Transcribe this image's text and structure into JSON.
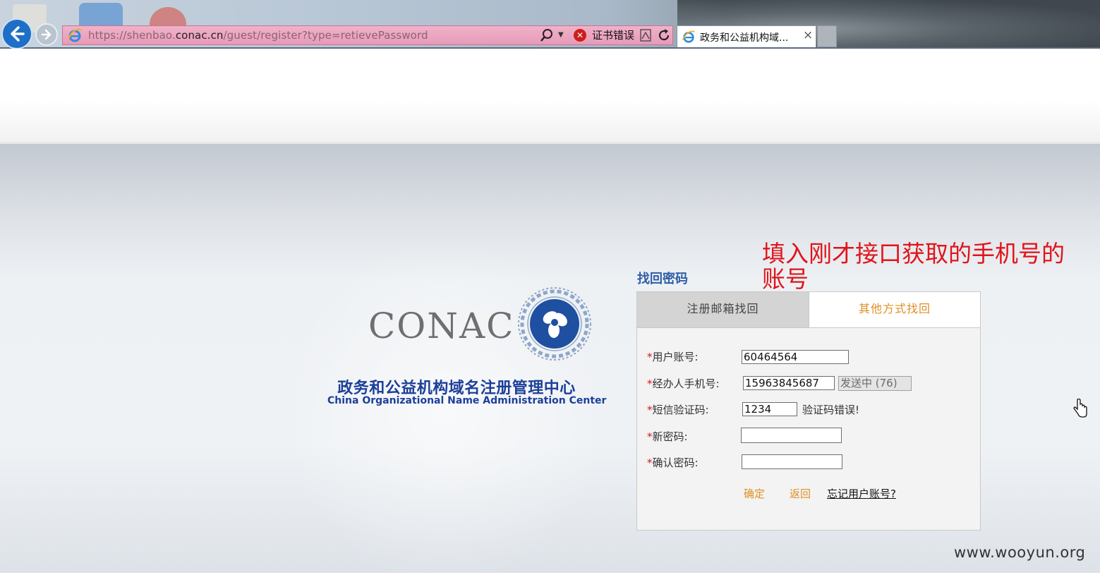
{
  "browser": {
    "url_prefix": "https://shenbao.",
    "url_domain": "conac.cn",
    "url_path": "/guest/register?type=retievePassword",
    "cert_error": "证书错误",
    "tab_title": "政务和公益机构域...",
    "tab_close": "×"
  },
  "logo": {
    "word": "CONAC",
    "cn_name": "政务和公益机构域名注册管理中心",
    "en_name": "China Organizational Name Administration Center"
  },
  "annotation": "填入刚才接口获取的手机号的账号",
  "form": {
    "title": "找回密码",
    "tabs": [
      {
        "label": "注册邮箱找回",
        "active": false
      },
      {
        "label": "其他方式找回",
        "active": true
      }
    ],
    "required_mark": "*",
    "fields": {
      "account": {
        "label": "用户账号:",
        "value": "60464564"
      },
      "phone": {
        "label": "经办人手机号:",
        "value": "15963845687"
      },
      "sms": {
        "label": "短信验证码:",
        "value": "1234"
      },
      "new_password": {
        "label": "新密码:",
        "value": ""
      },
      "confirm_password": {
        "label": "确认密码:",
        "value": ""
      }
    },
    "send_button": "发送中 (76)",
    "sms_error": "验证码错误!",
    "confirm_label": "确定",
    "back_label": "返回",
    "forgot_label": "忘记用户账号?"
  },
  "watermark": "www.wooyun.org",
  "colors": {
    "accent_orange": "#e08f24",
    "title_blue": "#2e5da8",
    "annotation_red": "#e0141a",
    "logo_blue": "#1d3f9a"
  },
  "icons": [
    "back-arrow-icon",
    "forward-arrow-icon",
    "ie-logo-icon",
    "search-icon",
    "dropdown-caret-icon",
    "cert-error-icon",
    "compat-view-icon",
    "refresh-icon",
    "close-icon",
    "conac-emblem-icon",
    "hand-cursor-icon"
  ]
}
